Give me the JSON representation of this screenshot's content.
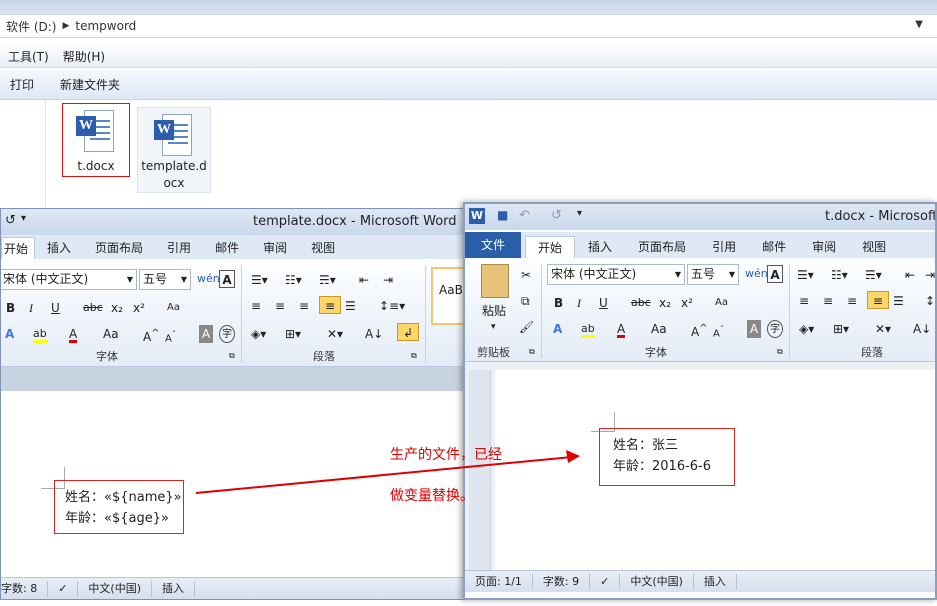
{
  "explorer": {
    "address": {
      "drive": "软件 (D:)",
      "folder": "tempword"
    },
    "menu": [
      "工具(T)",
      "帮助(H)"
    ],
    "toolbar": [
      "打印",
      "新建文件夹"
    ],
    "files": [
      {
        "name": "t.docx",
        "icon": "word-doc-icon"
      },
      {
        "name_line1": "template.d",
        "name_line2": "ocx",
        "icon": "word-doc-icon"
      }
    ]
  },
  "left_word": {
    "title": "template.docx  -  Microsoft Word",
    "tabs": [
      "开始",
      "插入",
      "页面布局",
      "引用",
      "邮件",
      "审阅",
      "视图"
    ],
    "font_name": "宋体 (中文正文)",
    "font_size": "五号",
    "groups": {
      "font": "字体",
      "paragraph": "段落"
    },
    "style_preview": "AaBl",
    "content": {
      "line1": "姓名：«${name}»",
      "line2": "年龄：«${age}»"
    },
    "status": {
      "words": "字数: 8",
      "lang": "中文(中国)",
      "mode": "插入"
    }
  },
  "right_word": {
    "title": "t.docx  -  Microsoft W",
    "tabs": {
      "file": "文件",
      "home": "开始",
      "insert": "插入",
      "layout": "页面布局",
      "refs": "引用",
      "mail": "邮件",
      "review": "审阅",
      "view": "视图"
    },
    "paste": "粘贴",
    "font_name": "宋体 (中文正文)",
    "font_size": "五号",
    "groups": {
      "clipboard": "剪贴板",
      "font": "字体",
      "paragraph": "段落"
    },
    "content": {
      "line1": "姓名：张三",
      "line2": "年龄：2016-6-6"
    },
    "status": {
      "page": "页面: 1/1",
      "words": "字数: 9",
      "lang": "中文(中国)",
      "mode": "插入"
    }
  },
  "annotation": {
    "line1": "生产的文件，已经",
    "line2": "做变量替换。",
    "color": "#dd0000"
  }
}
